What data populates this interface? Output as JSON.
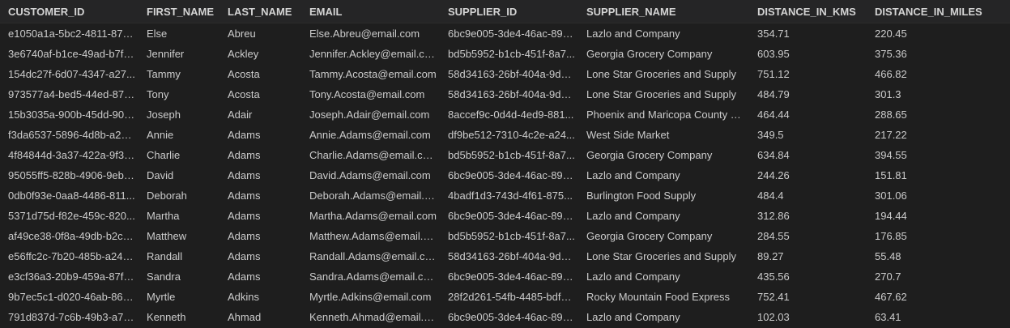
{
  "table": {
    "columns": [
      "CUSTOMER_ID",
      "FIRST_NAME",
      "LAST_NAME",
      "EMAIL",
      "SUPPLIER_ID",
      "SUPPLIER_NAME",
      "DISTANCE_IN_KMS",
      "DISTANCE_IN_MILES"
    ],
    "rows": [
      [
        "e1050a1a-5bc2-4811-875f...",
        "Else",
        "Abreu",
        "Else.Abreu@email.com",
        "6bc9e005-3de4-46ac-894...",
        "Lazlo and Company",
        "354.71",
        "220.45"
      ],
      [
        "3e6740af-b1ce-49ad-b7f3...",
        "Jennifer",
        "Ackley",
        "Jennifer.Ackley@email.com",
        "bd5b5952-b1cb-451f-8a7...",
        "Georgia Grocery Company",
        "603.95",
        "375.36"
      ],
      [
        "154dc27f-6d07-4347-a27...",
        "Tammy",
        "Acosta",
        "Tammy.Acosta@email.com",
        "58d34163-26bf-404a-9d9...",
        "Lone Star Groceries and Supply",
        "751.12",
        "466.82"
      ],
      [
        "973577a4-bed5-44ed-87d...",
        "Tony",
        "Acosta",
        "Tony.Acosta@email.com",
        "58d34163-26bf-404a-9d9...",
        "Lone Star Groceries and Supply",
        "484.79",
        "301.3"
      ],
      [
        "15b3035a-900b-45dd-901...",
        "Joseph",
        "Adair",
        "Joseph.Adair@email.com",
        "8accef9c-0d4d-4ed9-881...",
        "Phoenix and Maricopa County Su...",
        "464.44",
        "288.65"
      ],
      [
        "f3da6537-5896-4d8b-a22...",
        "Annie",
        "Adams",
        "Annie.Adams@email.com",
        "df9be512-7310-4c2e-a24...",
        "West Side Market",
        "349.5",
        "217.22"
      ],
      [
        "4f84844d-3a37-422a-9f3e...",
        "Charlie",
        "Adams",
        "Charlie.Adams@email.com",
        "bd5b5952-b1cb-451f-8a7...",
        "Georgia Grocery Company",
        "634.84",
        "394.55"
      ],
      [
        "95055ff5-828b-4906-9ebf...",
        "David",
        "Adams",
        "David.Adams@email.com",
        "6bc9e005-3de4-46ac-894...",
        "Lazlo and Company",
        "244.26",
        "151.81"
      ],
      [
        "0db0f93e-0aa8-4486-811...",
        "Deborah",
        "Adams",
        "Deborah.Adams@email.c...",
        "4badf1d3-743d-4f61-875...",
        "Burlington Food Supply",
        "484.4",
        "301.06"
      ],
      [
        "5371d75d-f82e-459c-820...",
        "Martha",
        "Adams",
        "Martha.Adams@email.com",
        "6bc9e005-3de4-46ac-894...",
        "Lazlo and Company",
        "312.86",
        "194.44"
      ],
      [
        "af49ce38-0f8a-49db-b2c1...",
        "Matthew",
        "Adams",
        "Matthew.Adams@email.c...",
        "bd5b5952-b1cb-451f-8a7...",
        "Georgia Grocery Company",
        "284.55",
        "176.85"
      ],
      [
        "e56ffc2c-7b20-485b-a242...",
        "Randall",
        "Adams",
        "Randall.Adams@email.com",
        "58d34163-26bf-404a-9d9...",
        "Lone Star Groceries and Supply",
        "89.27",
        "55.48"
      ],
      [
        "e3cf36a3-20b9-459a-87f7...",
        "Sandra",
        "Adams",
        "Sandra.Adams@email.com",
        "6bc9e005-3de4-46ac-894...",
        "Lazlo and Company",
        "435.56",
        "270.7"
      ],
      [
        "9b7ec5c1-d020-46ab-862...",
        "Myrtle",
        "Adkins",
        "Myrtle.Adkins@email.com",
        "28f2d261-54fb-4485-bdf2...",
        "Rocky Mountain Food Express",
        "752.41",
        "467.62"
      ],
      [
        "791d837d-7c6b-49b3-a72...",
        "Kenneth",
        "Ahmad",
        "Kenneth.Ahmad@email.co...",
        "6bc9e005-3de4-46ac-894...",
        "Lazlo and Company",
        "102.03",
        "63.41"
      ]
    ]
  },
  "colors": {
    "background": "#1e1e1e",
    "header_background": "#252526",
    "text": "#cccccc"
  }
}
